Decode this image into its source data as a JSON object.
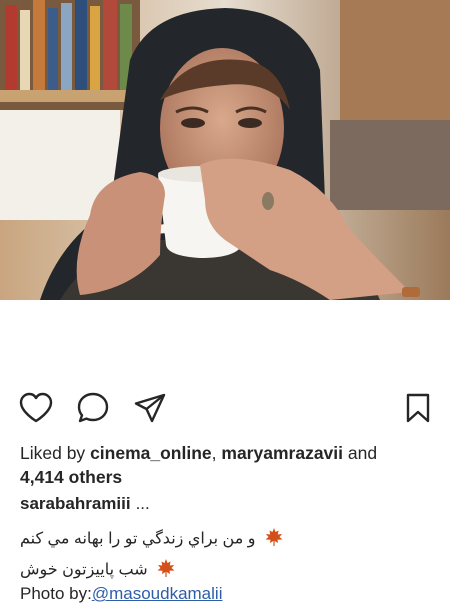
{
  "post": {
    "photo_alt": "woman drinking from cup",
    "likes_prefix": "Liked by",
    "liked_user_1": "cinema_online",
    "liked_sep": ",",
    "liked_user_2": "maryamrazavii",
    "likes_and": "and",
    "others_count": "4,414 others",
    "caption_user": "sarabahramiii",
    "caption_more": "...",
    "caption_line_1": "و من براي زندگي تو را بهانه مي كنم",
    "caption_line_2": "شب پاييزتون خوش",
    "photo_credit_prefix": "Photo by:",
    "photo_credit_handle": "@masoudkamalii"
  },
  "icons": {
    "like": "heart-icon",
    "comment": "comment-icon",
    "share": "send-icon",
    "save": "bookmark-icon",
    "leaf": "maple-leaf-emoji"
  },
  "colors": {
    "text": "#262626",
    "link": "#2e5ea8",
    "leaf": "#d4501a"
  }
}
